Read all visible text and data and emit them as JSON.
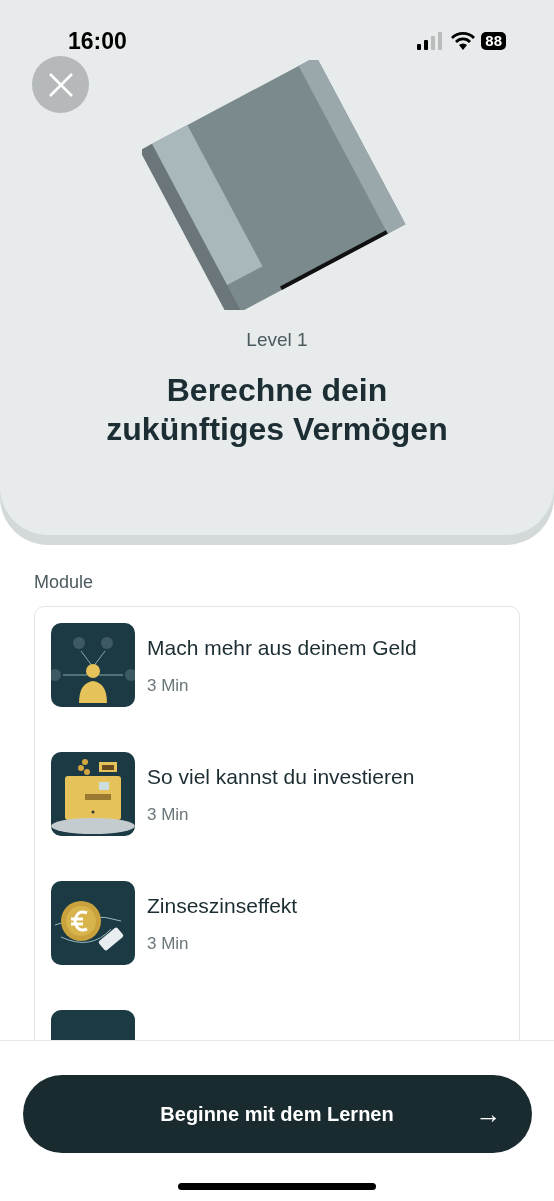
{
  "status_bar": {
    "time": "16:00",
    "battery": "88"
  },
  "header": {
    "level": "Level 1",
    "title": "Berechne dein zukünftiges Vermögen"
  },
  "modules": {
    "heading": "Module",
    "items": [
      {
        "kind": "people",
        "title": "Mach mehr aus deinem Geld",
        "duration": "3 Min"
      },
      {
        "kind": "register",
        "title": "So viel kannst du investieren",
        "duration": "3 Min"
      },
      {
        "kind": "coin",
        "title": "Zinseszinseffekt",
        "duration": "3 Min"
      },
      {
        "kind": "blank"
      }
    ]
  },
  "cta": {
    "label": "Beginne mit dem Lernen",
    "arrow": "→"
  }
}
